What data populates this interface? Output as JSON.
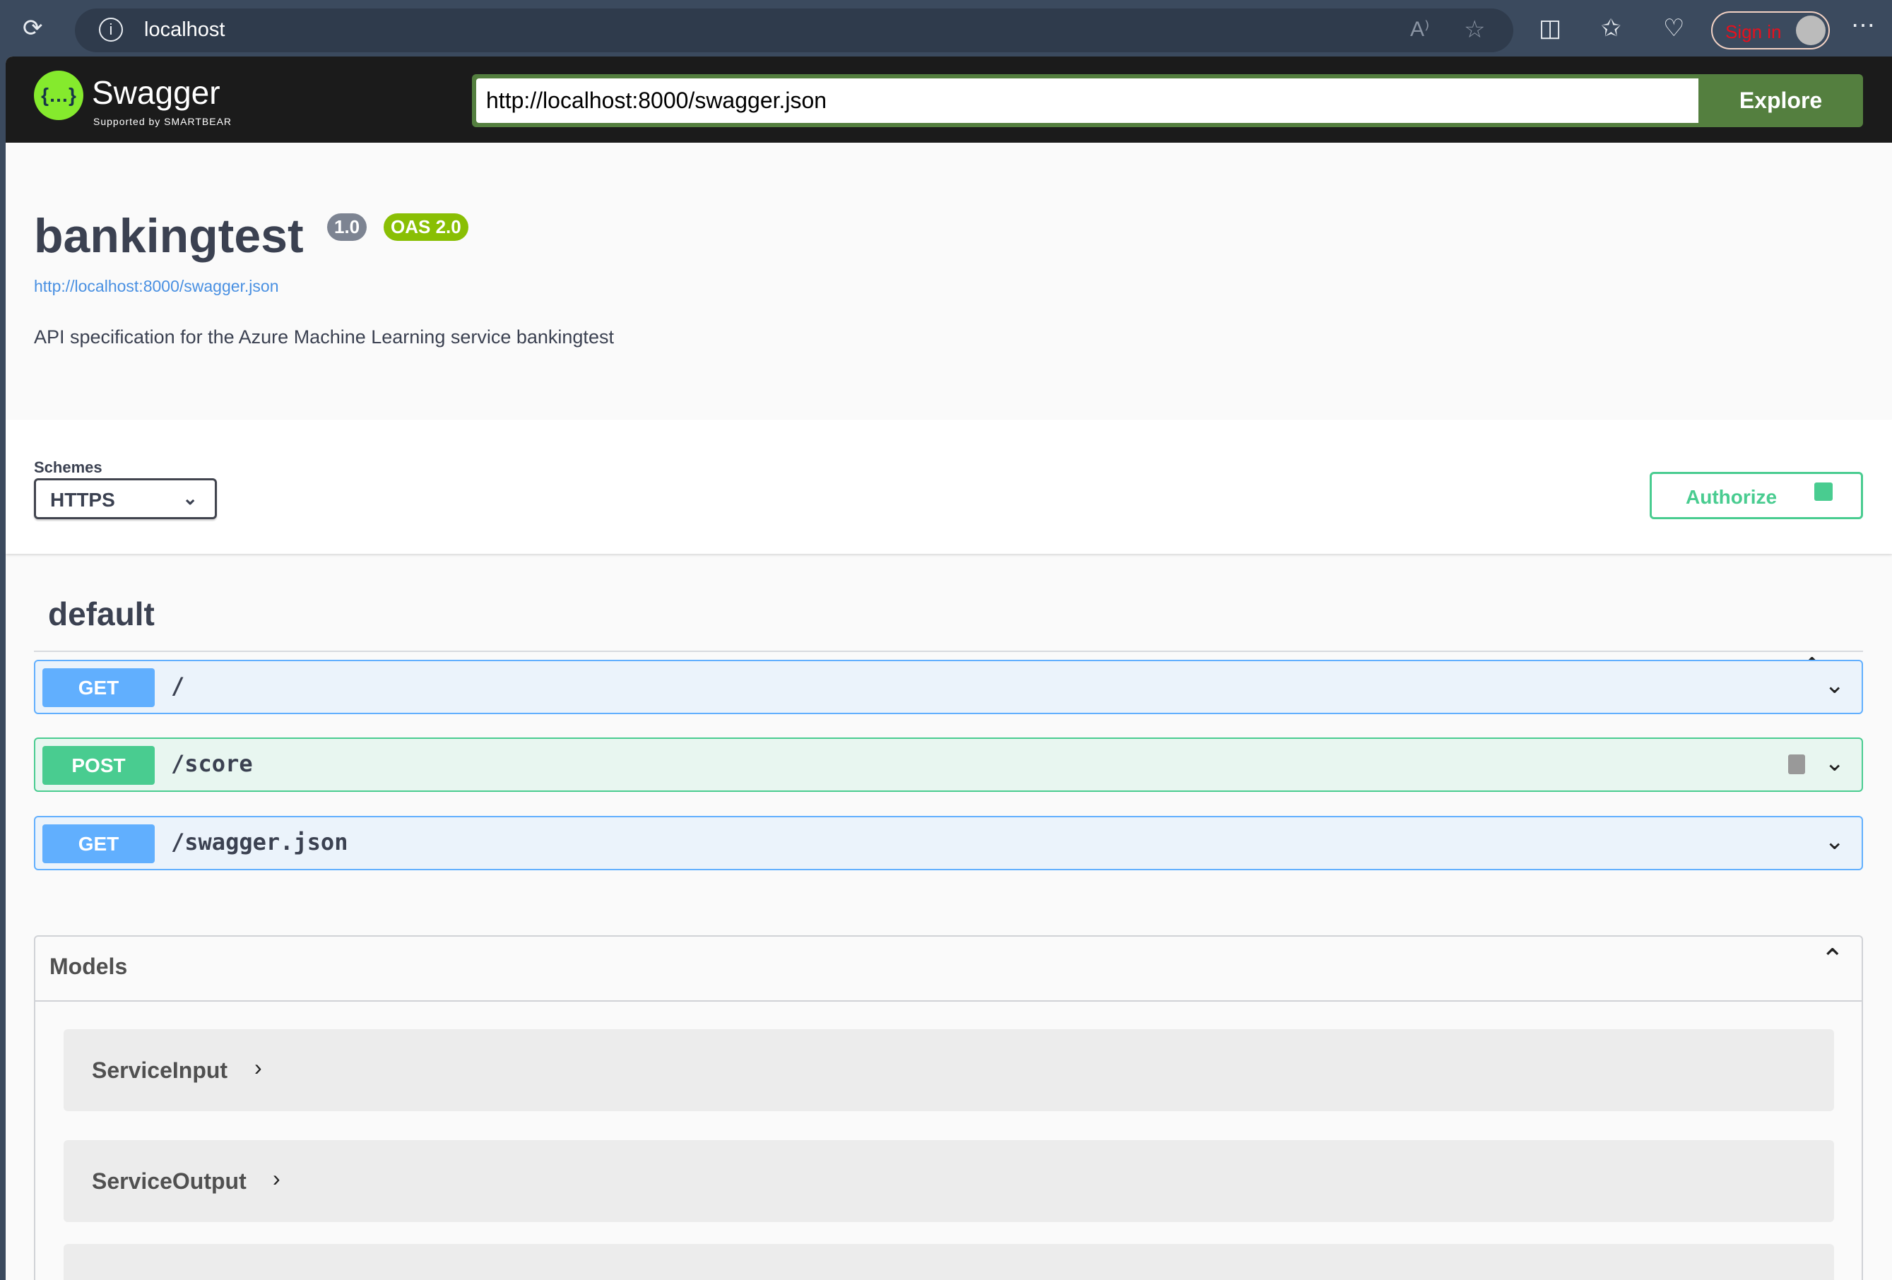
{
  "browser": {
    "address": "localhost",
    "sign_in": "Sign in"
  },
  "header": {
    "logo_text": "Swagger",
    "logo_sub": "Supported by SMARTBEAR",
    "url_value": "http://localhost:8000/swagger.json",
    "explore_label": "Explore"
  },
  "info": {
    "title": "bankingtest",
    "version": "1.0",
    "oas": "OAS 2.0",
    "spec_link": "http://localhost:8000/swagger.json",
    "description": "API specification for the Azure Machine Learning service bankingtest"
  },
  "schemes": {
    "label": "Schemes",
    "selected": "HTTPS",
    "authorize_label": "Authorize"
  },
  "tag": {
    "name": "default"
  },
  "operations": [
    {
      "method": "GET",
      "path": "/",
      "color": "#61affe",
      "bg": "#ebf3fb"
    },
    {
      "method": "POST",
      "path": "/score",
      "color": "#49cc90",
      "bg": "#e8f6f0",
      "locked": true
    },
    {
      "method": "GET",
      "path": "/swagger.json",
      "color": "#61affe",
      "bg": "#ebf3fb"
    }
  ],
  "models": {
    "title": "Models",
    "items": [
      {
        "name": "ServiceInput"
      },
      {
        "name": "ServiceOutput"
      }
    ]
  }
}
